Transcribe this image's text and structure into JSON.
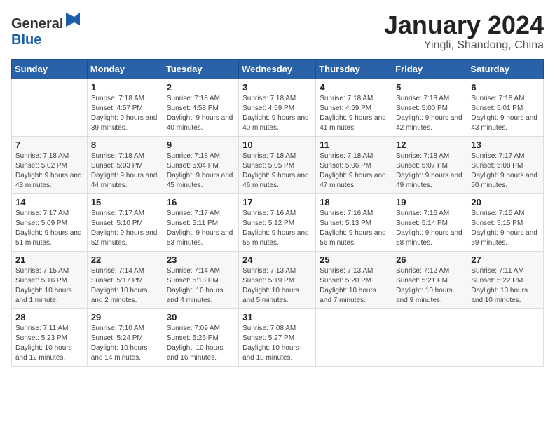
{
  "logo": {
    "text_general": "General",
    "text_blue": "Blue"
  },
  "title": {
    "month_year": "January 2024",
    "location": "Yingli, Shandong, China"
  },
  "headers": [
    "Sunday",
    "Monday",
    "Tuesday",
    "Wednesday",
    "Thursday",
    "Friday",
    "Saturday"
  ],
  "weeks": [
    [
      {
        "day": "",
        "sunrise": "",
        "sunset": "",
        "daylight": ""
      },
      {
        "day": "1",
        "sunrise": "Sunrise: 7:18 AM",
        "sunset": "Sunset: 4:57 PM",
        "daylight": "Daylight: 9 hours and 39 minutes."
      },
      {
        "day": "2",
        "sunrise": "Sunrise: 7:18 AM",
        "sunset": "Sunset: 4:58 PM",
        "daylight": "Daylight: 9 hours and 40 minutes."
      },
      {
        "day": "3",
        "sunrise": "Sunrise: 7:18 AM",
        "sunset": "Sunset: 4:59 PM",
        "daylight": "Daylight: 9 hours and 40 minutes."
      },
      {
        "day": "4",
        "sunrise": "Sunrise: 7:18 AM",
        "sunset": "Sunset: 4:59 PM",
        "daylight": "Daylight: 9 hours and 41 minutes."
      },
      {
        "day": "5",
        "sunrise": "Sunrise: 7:18 AM",
        "sunset": "Sunset: 5:00 PM",
        "daylight": "Daylight: 9 hours and 42 minutes."
      },
      {
        "day": "6",
        "sunrise": "Sunrise: 7:18 AM",
        "sunset": "Sunset: 5:01 PM",
        "daylight": "Daylight: 9 hours and 43 minutes."
      }
    ],
    [
      {
        "day": "7",
        "sunrise": "Sunrise: 7:18 AM",
        "sunset": "Sunset: 5:02 PM",
        "daylight": "Daylight: 9 hours and 43 minutes."
      },
      {
        "day": "8",
        "sunrise": "Sunrise: 7:18 AM",
        "sunset": "Sunset: 5:03 PM",
        "daylight": "Daylight: 9 hours and 44 minutes."
      },
      {
        "day": "9",
        "sunrise": "Sunrise: 7:18 AM",
        "sunset": "Sunset: 5:04 PM",
        "daylight": "Daylight: 9 hours and 45 minutes."
      },
      {
        "day": "10",
        "sunrise": "Sunrise: 7:18 AM",
        "sunset": "Sunset: 5:05 PM",
        "daylight": "Daylight: 9 hours and 46 minutes."
      },
      {
        "day": "11",
        "sunrise": "Sunrise: 7:18 AM",
        "sunset": "Sunset: 5:06 PM",
        "daylight": "Daylight: 9 hours and 47 minutes."
      },
      {
        "day": "12",
        "sunrise": "Sunrise: 7:18 AM",
        "sunset": "Sunset: 5:07 PM",
        "daylight": "Daylight: 9 hours and 49 minutes."
      },
      {
        "day": "13",
        "sunrise": "Sunrise: 7:17 AM",
        "sunset": "Sunset: 5:08 PM",
        "daylight": "Daylight: 9 hours and 50 minutes."
      }
    ],
    [
      {
        "day": "14",
        "sunrise": "Sunrise: 7:17 AM",
        "sunset": "Sunset: 5:09 PM",
        "daylight": "Daylight: 9 hours and 51 minutes."
      },
      {
        "day": "15",
        "sunrise": "Sunrise: 7:17 AM",
        "sunset": "Sunset: 5:10 PM",
        "daylight": "Daylight: 9 hours and 52 minutes."
      },
      {
        "day": "16",
        "sunrise": "Sunrise: 7:17 AM",
        "sunset": "Sunset: 5:11 PM",
        "daylight": "Daylight: 9 hours and 53 minutes."
      },
      {
        "day": "17",
        "sunrise": "Sunrise: 7:16 AM",
        "sunset": "Sunset: 5:12 PM",
        "daylight": "Daylight: 9 hours and 55 minutes."
      },
      {
        "day": "18",
        "sunrise": "Sunrise: 7:16 AM",
        "sunset": "Sunset: 5:13 PM",
        "daylight": "Daylight: 9 hours and 56 minutes."
      },
      {
        "day": "19",
        "sunrise": "Sunrise: 7:16 AM",
        "sunset": "Sunset: 5:14 PM",
        "daylight": "Daylight: 9 hours and 58 minutes."
      },
      {
        "day": "20",
        "sunrise": "Sunrise: 7:15 AM",
        "sunset": "Sunset: 5:15 PM",
        "daylight": "Daylight: 9 hours and 59 minutes."
      }
    ],
    [
      {
        "day": "21",
        "sunrise": "Sunrise: 7:15 AM",
        "sunset": "Sunset: 5:16 PM",
        "daylight": "Daylight: 10 hours and 1 minute."
      },
      {
        "day": "22",
        "sunrise": "Sunrise: 7:14 AM",
        "sunset": "Sunset: 5:17 PM",
        "daylight": "Daylight: 10 hours and 2 minutes."
      },
      {
        "day": "23",
        "sunrise": "Sunrise: 7:14 AM",
        "sunset": "Sunset: 5:18 PM",
        "daylight": "Daylight: 10 hours and 4 minutes."
      },
      {
        "day": "24",
        "sunrise": "Sunrise: 7:13 AM",
        "sunset": "Sunset: 5:19 PM",
        "daylight": "Daylight: 10 hours and 5 minutes."
      },
      {
        "day": "25",
        "sunrise": "Sunrise: 7:13 AM",
        "sunset": "Sunset: 5:20 PM",
        "daylight": "Daylight: 10 hours and 7 minutes."
      },
      {
        "day": "26",
        "sunrise": "Sunrise: 7:12 AM",
        "sunset": "Sunset: 5:21 PM",
        "daylight": "Daylight: 10 hours and 9 minutes."
      },
      {
        "day": "27",
        "sunrise": "Sunrise: 7:11 AM",
        "sunset": "Sunset: 5:22 PM",
        "daylight": "Daylight: 10 hours and 10 minutes."
      }
    ],
    [
      {
        "day": "28",
        "sunrise": "Sunrise: 7:11 AM",
        "sunset": "Sunset: 5:23 PM",
        "daylight": "Daylight: 10 hours and 12 minutes."
      },
      {
        "day": "29",
        "sunrise": "Sunrise: 7:10 AM",
        "sunset": "Sunset: 5:24 PM",
        "daylight": "Daylight: 10 hours and 14 minutes."
      },
      {
        "day": "30",
        "sunrise": "Sunrise: 7:09 AM",
        "sunset": "Sunset: 5:26 PM",
        "daylight": "Daylight: 10 hours and 16 minutes."
      },
      {
        "day": "31",
        "sunrise": "Sunrise: 7:08 AM",
        "sunset": "Sunset: 5:27 PM",
        "daylight": "Daylight: 10 hours and 18 minutes."
      },
      {
        "day": "",
        "sunrise": "",
        "sunset": "",
        "daylight": ""
      },
      {
        "day": "",
        "sunrise": "",
        "sunset": "",
        "daylight": ""
      },
      {
        "day": "",
        "sunrise": "",
        "sunset": "",
        "daylight": ""
      }
    ]
  ]
}
